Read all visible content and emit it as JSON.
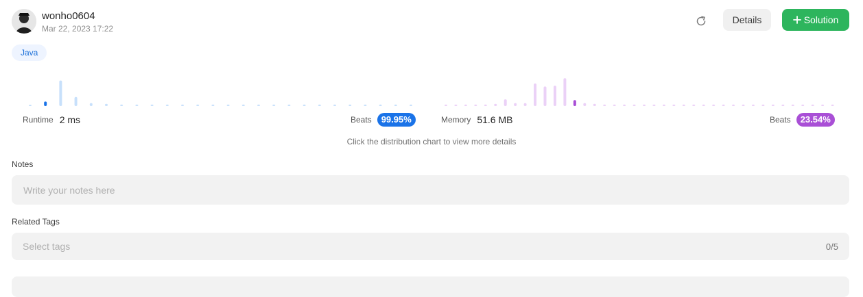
{
  "header": {
    "username": "wonho0604",
    "timestamp": "Mar 22, 2023 17:22",
    "details_label": "Details",
    "solution_label": "Solution",
    "refresh_icon": "refresh-icon",
    "plus_icon": "plus-icon"
  },
  "language_tag": "Java",
  "runtime": {
    "label": "Runtime",
    "value": "2 ms",
    "beats_label": "Beats",
    "beats_value": "99.95%",
    "accent": "#1a73e8",
    "bar_color": "#c7e0fb"
  },
  "memory": {
    "label": "Memory",
    "value": "51.6 MB",
    "beats_label": "Beats",
    "beats_value": "23.54%",
    "accent": "#a94fd6",
    "bar_color": "#ebd1f7"
  },
  "chart_data": [
    {
      "type": "bar",
      "name": "runtime-distribution",
      "values": [
        1,
        6,
        34,
        12,
        4,
        3,
        2,
        2,
        2,
        2,
        2,
        2,
        2,
        2,
        2,
        2,
        2,
        2,
        2,
        2,
        2,
        2,
        2,
        2,
        2,
        2
      ],
      "highlight_index": 1,
      "ylim": [
        0,
        40
      ]
    },
    {
      "type": "bar",
      "name": "memory-distribution",
      "values": [
        2,
        2,
        2,
        2,
        2,
        3,
        9,
        4,
        4,
        30,
        26,
        27,
        37,
        8,
        4,
        3,
        2,
        2,
        2,
        2,
        2,
        2,
        2,
        2,
        2,
        2,
        2,
        2,
        2,
        2,
        2,
        2,
        2,
        2,
        2,
        2,
        2,
        2,
        2,
        2,
        2
      ],
      "highlight_index": 13,
      "ylim": [
        0,
        40
      ]
    }
  ],
  "hint": "Click the distribution chart to view more details",
  "notes": {
    "label": "Notes",
    "placeholder": "Write your notes here"
  },
  "tags": {
    "label": "Related Tags",
    "placeholder": "Select tags",
    "count": "0/5"
  }
}
